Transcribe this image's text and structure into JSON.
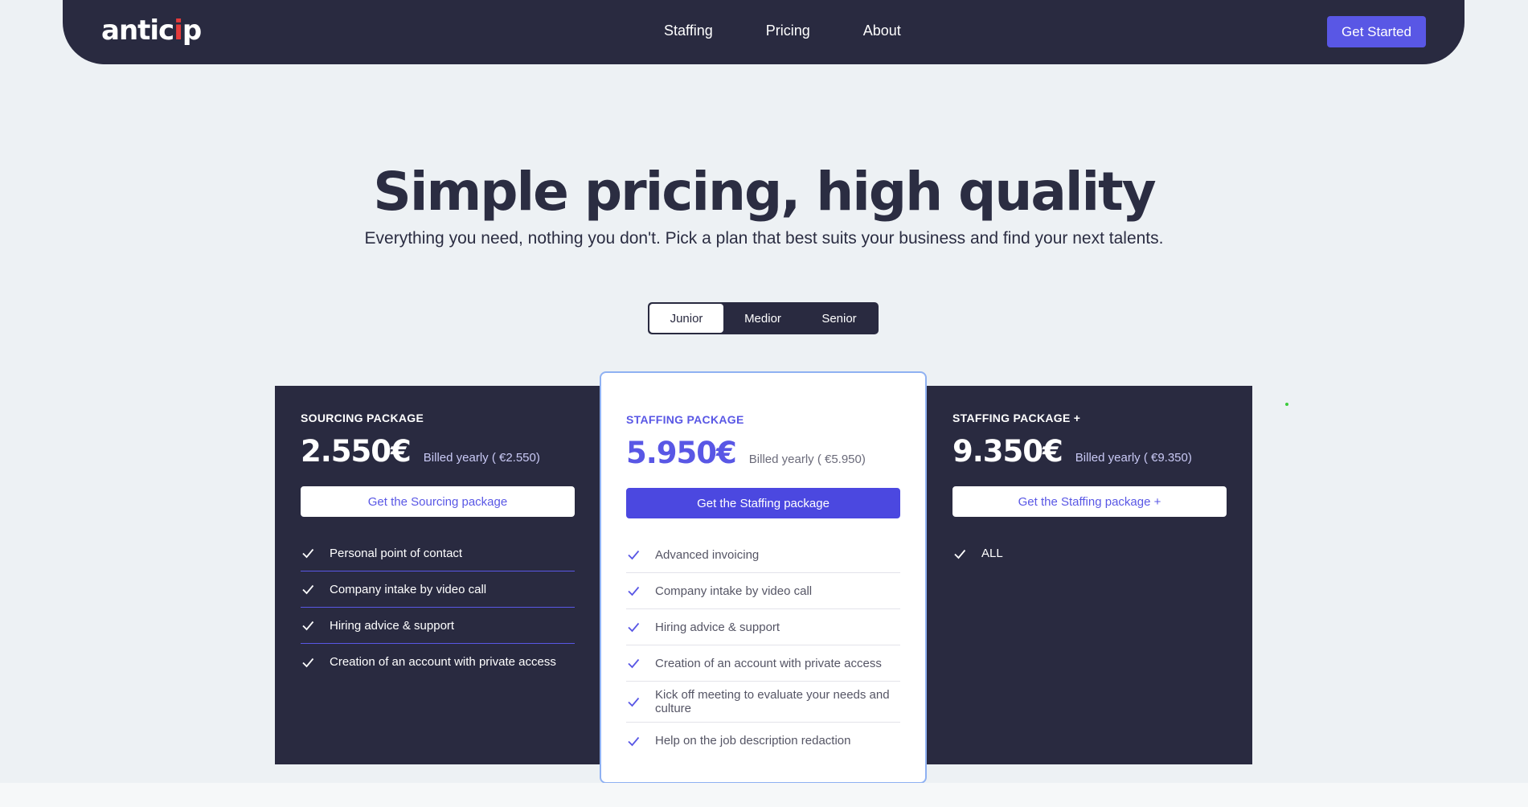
{
  "nav": {
    "logo_pre": "antic",
    "logo_mark": "i",
    "logo_post": "p",
    "links": [
      "Staffing",
      "Pricing",
      "About"
    ],
    "cta": "Get Started"
  },
  "hero": {
    "title": "Simple pricing, high quality",
    "subtitle": "Everything you need, nothing you don't. Pick a plan that best suits your business and find your next talents."
  },
  "toggle": {
    "options": [
      "Junior",
      "Medior",
      "Senior"
    ],
    "selected": "Junior"
  },
  "plans": [
    {
      "title": "SOURCING PACKAGE",
      "price": "2.550€",
      "billed": "Billed yearly ( €2.550)",
      "cta": "Get the Sourcing package",
      "features": [
        "Personal point of contact",
        "Company intake by video call",
        "Hiring advice & support",
        "Creation of an account with private access"
      ]
    },
    {
      "title": "STAFFING PACKAGE",
      "price": "5.950€",
      "billed": "Billed yearly ( €5.950)",
      "cta": "Get the Staffing package",
      "features": [
        "Advanced invoicing",
        "Company intake by video call",
        "Hiring advice & support",
        "Creation of an account with private access",
        "Kick off meeting to evaluate your needs and culture",
        "Help on the job description redaction"
      ]
    },
    {
      "title": "STAFFING PACKAGE +",
      "price": "9.350€",
      "billed": "Billed yearly ( €9.350)",
      "cta": "Get the Staffing package +",
      "features": [
        "ALL"
      ]
    }
  ],
  "colors": {
    "dark": "#292a40",
    "accent": "#5957e5",
    "background": "#edf1f4",
    "logo_mark": "#e53a3a"
  },
  "icons": {
    "feature": "check-icon"
  }
}
